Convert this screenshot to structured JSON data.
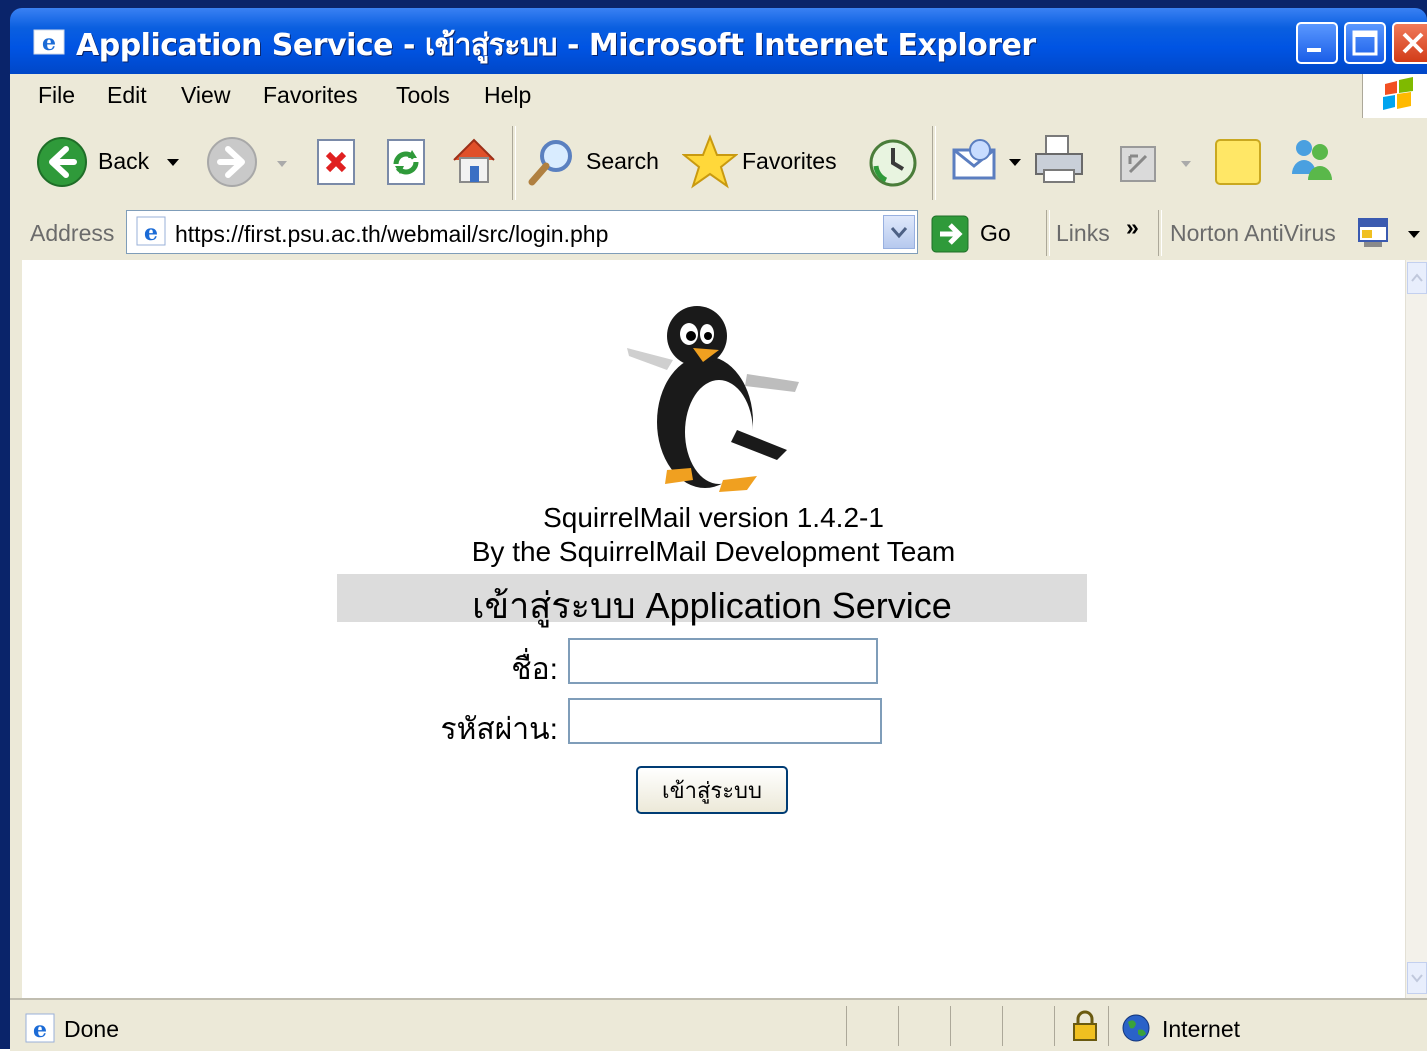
{
  "window": {
    "title": "Application Service - เข้าสู่ระบบ - Microsoft Internet Explorer"
  },
  "menu": {
    "items": [
      "File",
      "Edit",
      "View",
      "Favorites",
      "Tools",
      "Help"
    ]
  },
  "toolbar": {
    "back_label": "Back",
    "search_label": "Search",
    "favorites_label": "Favorites"
  },
  "address": {
    "label": "Address",
    "url": "https://first.psu.ac.th/webmail/src/login.php",
    "go_label": "Go",
    "links_label": "Links",
    "links_chevron": "»",
    "norton_label": "Norton AntiVirus"
  },
  "page": {
    "version_line": "SquirrelMail version 1.4.2-1",
    "team_line": "By the SquirrelMail Development Team",
    "banner": "เข้าสู่ระบบ Application Service",
    "username_label": "ชื่อ:",
    "password_label": "รหัสผ่าน:",
    "username_value": "",
    "password_value": "",
    "login_button": "เข้าสู่ระบบ"
  },
  "status": {
    "text": "Done",
    "zone": "Internet"
  },
  "colors": {
    "titlebar": "#0054e3",
    "chrome": "#ece9d8",
    "banner_bg": "#dcdcdc",
    "input_border": "#7f9db9"
  }
}
